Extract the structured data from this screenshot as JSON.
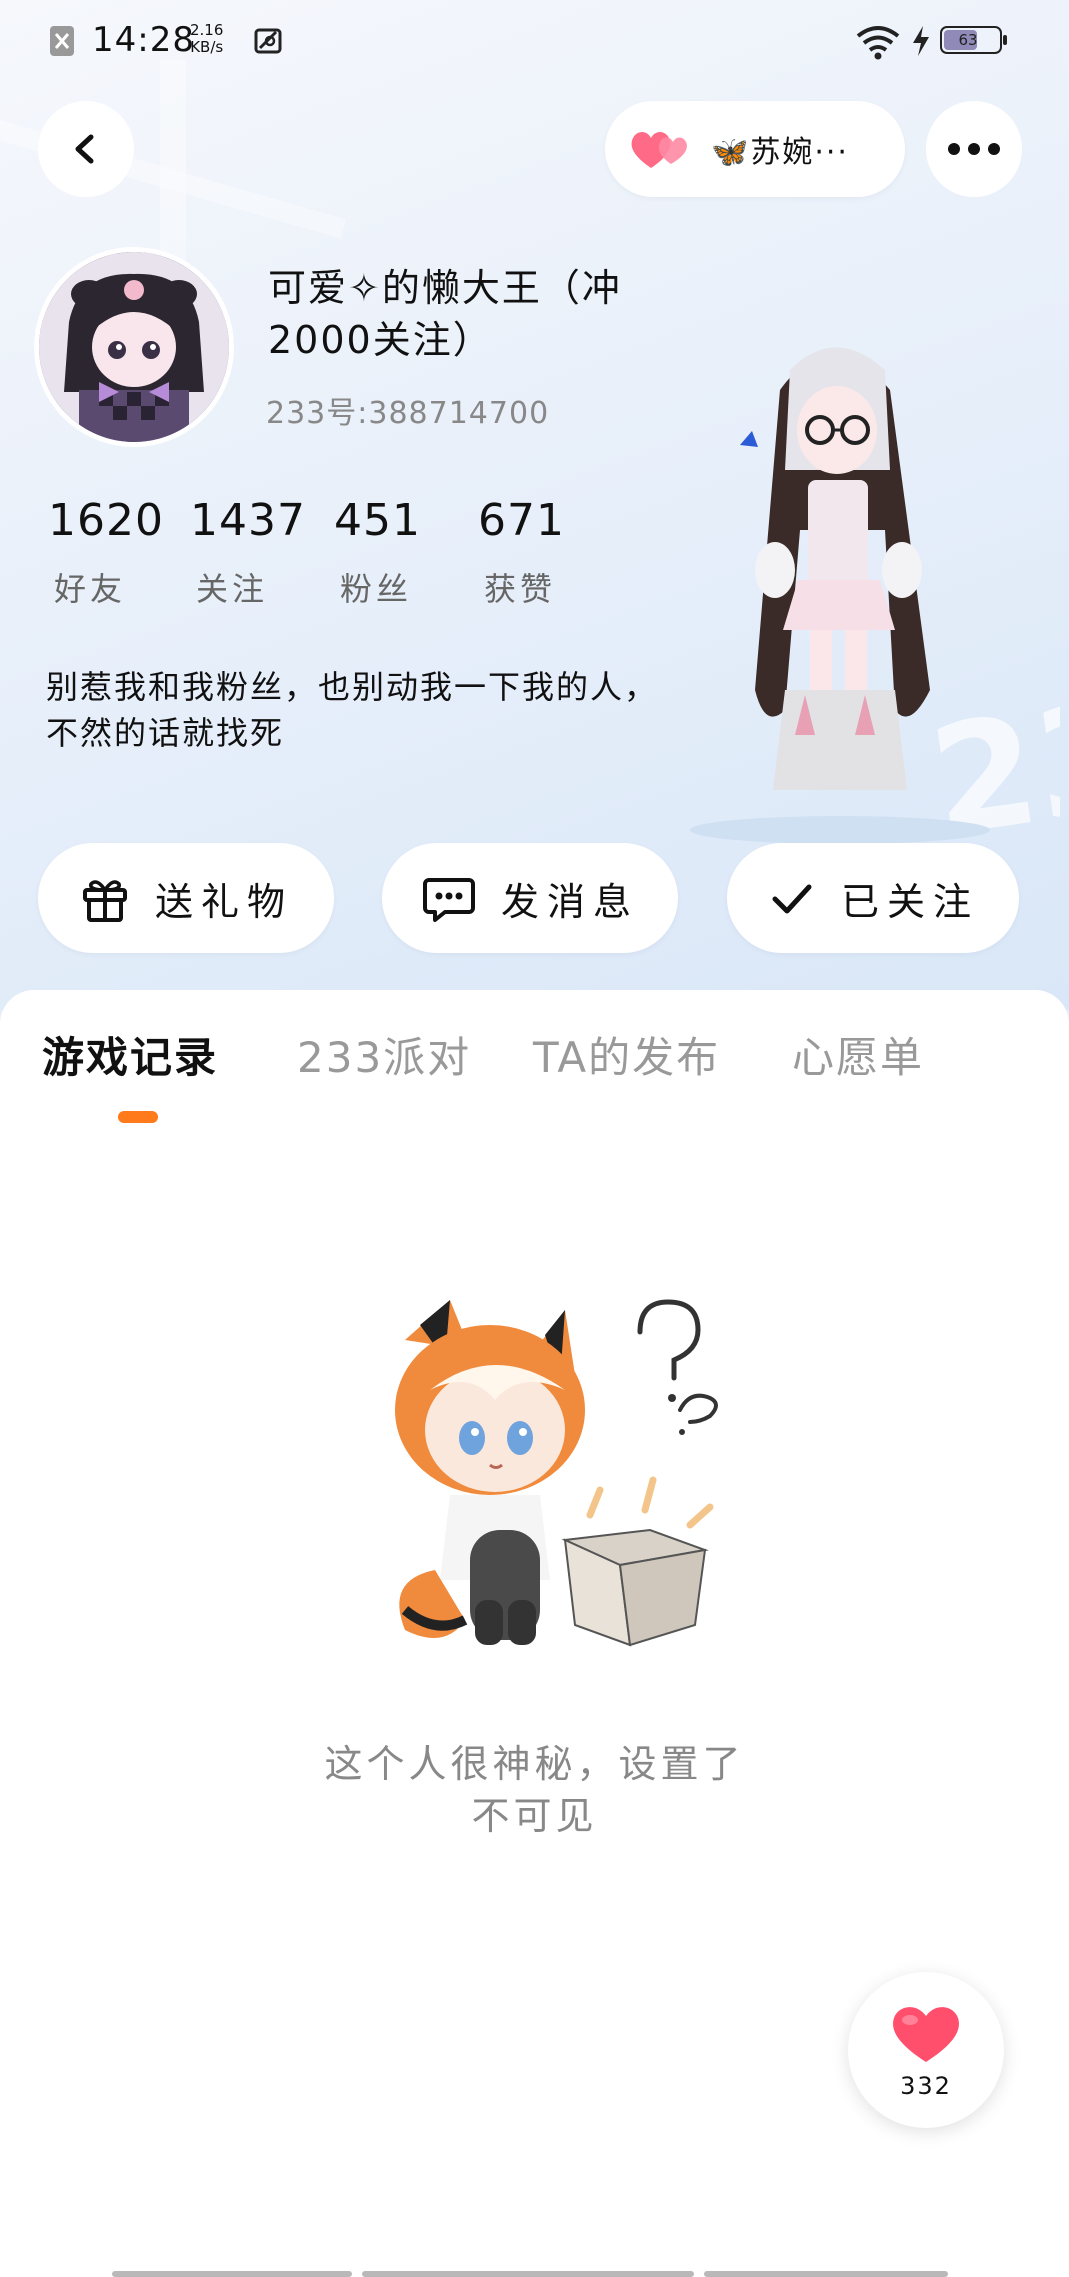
{
  "status_bar": {
    "time": "14:28",
    "net_speed_value": "2.16",
    "net_speed_unit": "KB/s",
    "battery": "63",
    "battery_level": 0.63
  },
  "top_bar": {
    "visitor_name": "🦋苏婉···",
    "back_icon": "chevron-left-icon",
    "more_icon": "more-dots-icon"
  },
  "profile": {
    "name": "可爱✧的懒大王（冲2000关注）",
    "uid": "233号:388714700",
    "bio": "别惹我和我粉丝，也别动我一下我的人，不然的话就找死",
    "stats": [
      {
        "value": "1620",
        "label": "好友"
      },
      {
        "value": "1437",
        "label": "关注"
      },
      {
        "value": "451",
        "label": "粉丝"
      },
      {
        "value": "671",
        "label": "获赞"
      }
    ]
  },
  "actions": {
    "gift": "送礼物",
    "message": "发消息",
    "follow": "已关注"
  },
  "tabs": [
    {
      "label": "游戏记录",
      "active": true
    },
    {
      "label": "233派对",
      "active": false
    },
    {
      "label": "TA的发布",
      "active": false
    },
    {
      "label": "心愿单",
      "active": false
    }
  ],
  "empty_state": {
    "line1": "这个人很神秘，设置了",
    "line2": "不可见"
  },
  "like": {
    "count": "332"
  },
  "colors": {
    "accent": "#ff7a1a",
    "heart": "#ff4f6d"
  }
}
